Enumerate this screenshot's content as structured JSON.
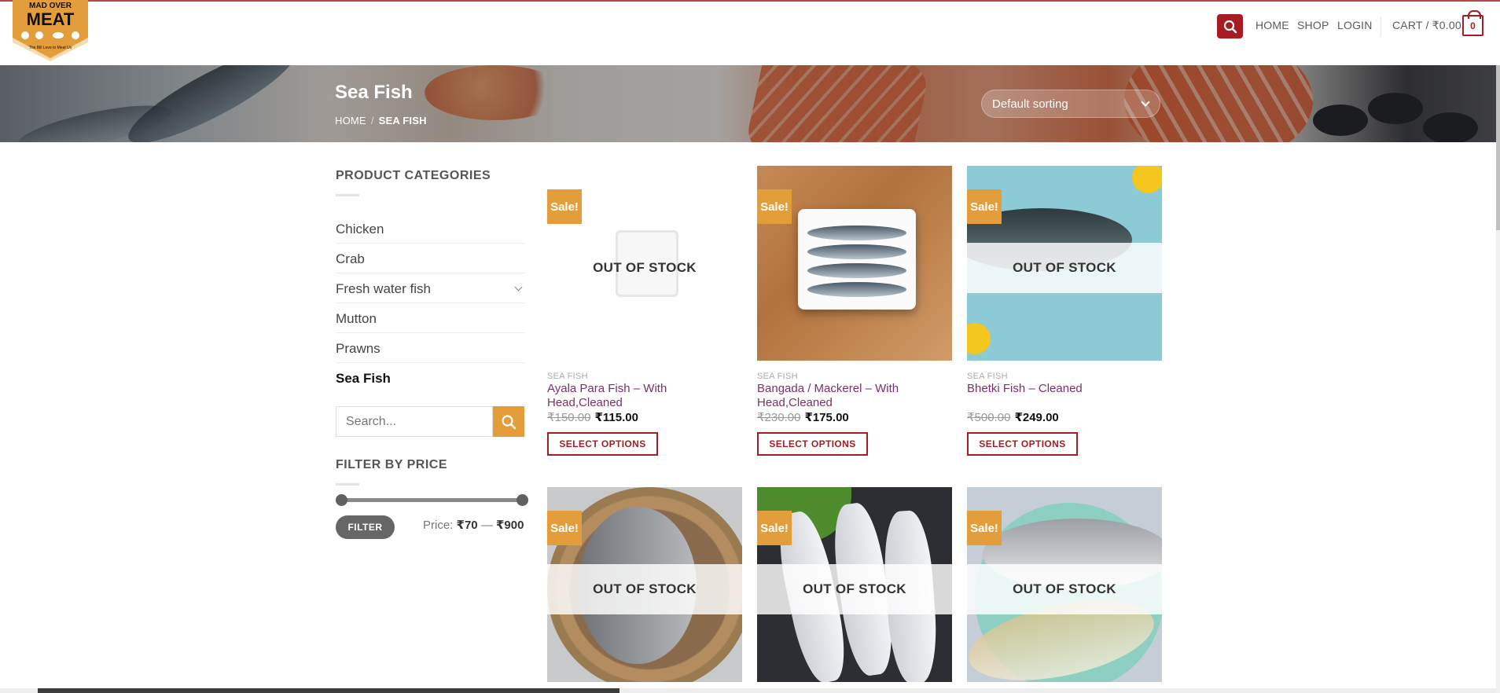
{
  "header": {
    "logo": {
      "brand_text": "MEAT",
      "top_text": "MAD OVER",
      "tagline": "The Bill Love to Meat Us"
    },
    "nav": {
      "home": "HOME",
      "shop": "SHOP",
      "login": "LOGIN"
    },
    "cart": {
      "label": "CART / ₹0.00",
      "count": "0"
    },
    "accent_color": "#a51d22"
  },
  "hero": {
    "title": "Sea Fish",
    "breadcrumb": {
      "home": "HOME",
      "separator": "/",
      "current": "SEA FISH"
    },
    "sorting": {
      "selected": "Default sorting"
    }
  },
  "sidebar": {
    "categories_title": "PRODUCT CATEGORIES",
    "categories": [
      {
        "label": "Chicken"
      },
      {
        "label": "Crab"
      },
      {
        "label": "Fresh water fish"
      },
      {
        "label": "Mutton"
      },
      {
        "label": "Prawns"
      },
      {
        "label": "Sea Fish"
      }
    ],
    "search_placeholder": "Search...",
    "filter_title": "FILTER BY PRICE",
    "filter_button": "FILTER",
    "price_prefix": "Price:",
    "price_min": "₹70",
    "price_dash": "—",
    "price_max": "₹900",
    "accent_color": "#e39d3a"
  },
  "products": [
    {
      "badge": "Sale!",
      "stock": "OUT OF STOCK",
      "category": "SEA FISH",
      "name": "Ayala Para Fish – With Head,Cleaned",
      "old_price": "₹150.00",
      "price": "₹115.00",
      "button": "SELECT OPTIONS"
    },
    {
      "badge": "Sale!",
      "stock": "",
      "category": "SEA FISH",
      "name": "Bangada / Mackerel – With Head,Cleaned",
      "old_price": "₹230.00",
      "price": "₹175.00",
      "button": "SELECT OPTIONS"
    },
    {
      "badge": "Sale!",
      "stock": "OUT OF STOCK",
      "category": "SEA FISH",
      "name": "Bhetki Fish – Cleaned",
      "old_price": "₹500.00",
      "price": "₹249.00",
      "button": "SELECT OPTIONS"
    },
    {
      "badge": "Sale!",
      "stock": "OUT OF STOCK"
    },
    {
      "badge": "Sale!",
      "stock": "OUT OF STOCK"
    },
    {
      "badge": "Sale!",
      "stock": "OUT OF STOCK"
    }
  ]
}
